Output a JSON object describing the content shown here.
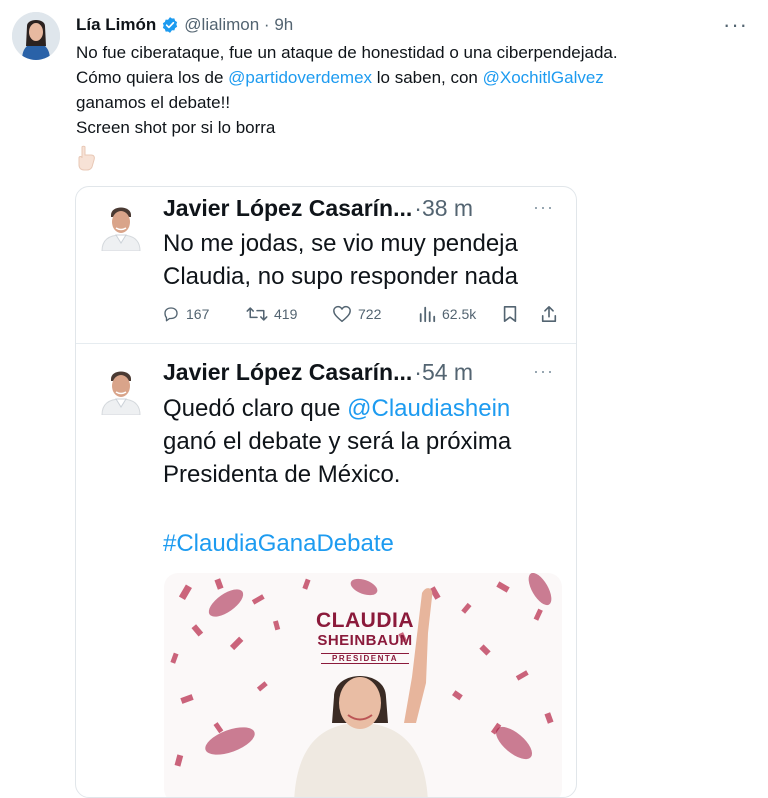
{
  "tweet": {
    "name": "Lía Limón",
    "handle": "@lialimon",
    "separator": "·",
    "time": "9h",
    "more": "···",
    "lines": [
      [
        {
          "t": "No fue ciberataque, fue un ataque de honestidad o una ciberpendejada."
        }
      ],
      [
        {
          "t": "Cómo quiera los de "
        },
        {
          "t": "@partidoverdemex",
          "link": true
        },
        {
          "t": " lo saben, con "
        },
        {
          "t": "@XochitlGalvez",
          "link": true
        }
      ],
      [
        {
          "t": "ganamos el debate!!"
        }
      ],
      [
        {
          "t": "Screen shot por si lo borra"
        }
      ]
    ],
    "emoji_icon": "pointing-down-hand-icon"
  },
  "card": {
    "first": {
      "author": "Javier López Casarín...",
      "time": "·38 m",
      "more": "···",
      "lines": [
        "No me jodas, se vio muy pendeja",
        "Claudia, no supo responder nada"
      ],
      "stats": {
        "replies": "167",
        "retweets": "419",
        "likes": "722",
        "views": "62.5k"
      }
    },
    "second": {
      "author": "Javier López Casarín...",
      "time": "·54 m",
      "more": "···",
      "lines": [
        [
          {
            "t": "Quedó claro que "
          },
          {
            "t": "@Claudiashein",
            "link": true
          }
        ],
        [
          {
            "t": "ganó el debate y será la próxima"
          }
        ],
        [
          {
            "t": "Presidenta de México."
          }
        ]
      ],
      "hashtag": "#ClaudiaGanaDebate",
      "poster": {
        "line1": "CLAUDIA",
        "line2": "SHEINBAUM",
        "line3": "PRESIDENTA"
      }
    }
  },
  "colors": {
    "link": "#1d9bf0",
    "secondary": "#536471",
    "brand": "#8b1a3b"
  }
}
